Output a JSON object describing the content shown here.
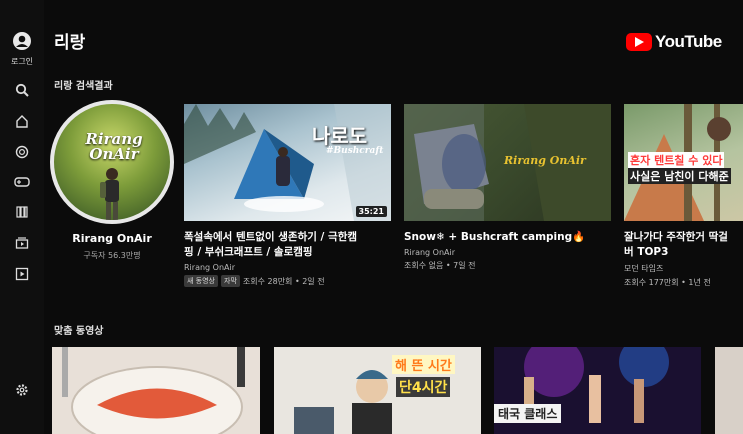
{
  "sidebar": {
    "login_label": "로그인",
    "items": [
      {
        "icon": "account-icon"
      },
      {
        "icon": "search-icon"
      },
      {
        "icon": "home-icon"
      },
      {
        "icon": "shorts-icon"
      },
      {
        "icon": "gaming-icon"
      },
      {
        "icon": "library-icon"
      },
      {
        "icon": "subscriptions-icon"
      },
      {
        "icon": "playlist-icon"
      },
      {
        "icon": "settings-icon"
      }
    ]
  },
  "header": {
    "title": "리랑",
    "logo_text": "YouTube"
  },
  "colors": {
    "brand_red": "#ff0000",
    "background": "#0b0b0b",
    "sidebar_bg": "#0f0f0f"
  },
  "search_results": {
    "section_label": "리랑 검색결과",
    "channel": {
      "name": "Rirang OnAir",
      "subscribers": "구독자 56.3만명",
      "avatar_text": "Rirang OnAir"
    },
    "videos": [
      {
        "title_line1": "폭설속에서 텐트없이 생존하기 / 극한캠",
        "title_line2": "핑 / 부쉬크래프트 / 솔로캠핑",
        "channel": "Rirang OnAir",
        "badges": [
          "새 동영상",
          "자막"
        ],
        "meta": "조회수 28만회 • 2일 전",
        "duration": "35:21",
        "thumb_text_big": "나로도",
        "thumb_text_small": "#Bushcraft"
      },
      {
        "title_line1": "Snow❄ + Bushcraft camping🔥",
        "title_line2": "",
        "channel": "Rirang OnAir",
        "badges": [],
        "meta": "조회수 없음 • 7일 전",
        "thumb_text": "Rirang OnAir"
      },
      {
        "title_line1": "잘나가다 주작한거 딱걸",
        "title_line2": "버 TOP3",
        "channel": "모던 타임즈",
        "badges": [],
        "meta": "조회수 177만회 • 1년 전",
        "thumb_text_1": "혼자 텐트칠 수 있다",
        "thumb_text_2": "사실은 남친이 다해준"
      }
    ]
  },
  "recommended": {
    "section_label": "맞춤 동영상",
    "thumbs": [
      {
        "text_1": "",
        "text_2": ""
      },
      {
        "text_1": "해 뜬 시간",
        "text_2": "단4시간"
      },
      {
        "text_1": "태국 클래스",
        "text_2": ""
      },
      {
        "text_1": "",
        "text_2": ""
      }
    ]
  }
}
